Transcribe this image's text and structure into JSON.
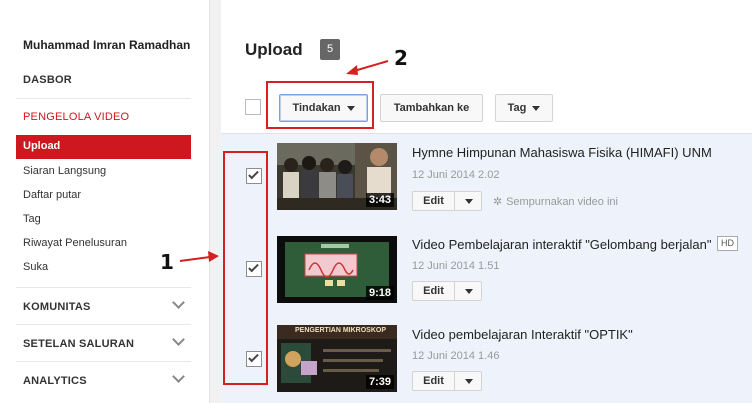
{
  "sidebar": {
    "user_name": "Muhammad Imran Ramadhan",
    "dasbor": "DASBOR",
    "section_title": "PENGELOLA VIDEO",
    "items": [
      {
        "label": "Upload",
        "active": true
      },
      {
        "label": "Siaran Langsung"
      },
      {
        "label": "Daftar putar"
      },
      {
        "label": "Tag"
      },
      {
        "label": "Riwayat Penelusuran"
      },
      {
        "label": "Suka"
      }
    ],
    "sections": [
      {
        "label": "KOMUNITAS"
      },
      {
        "label": "SETELAN SALURAN"
      },
      {
        "label": "ANALYTICS"
      }
    ]
  },
  "header": {
    "title": "Upload",
    "count": "5"
  },
  "toolbar": {
    "actions_label": "Tindakan",
    "add_to_label": "Tambahkan ke",
    "tag_label": "Tag"
  },
  "videos": [
    {
      "title": "Hymne Himpunan Mahasiswa Fisika (HIMAFI) UNM",
      "date": "12 Juni 2014 2.02",
      "duration": "3:43",
      "edit": "Edit",
      "enhance": "Sempurnakan video ini",
      "checked": true
    },
    {
      "title": "Video Pembelajaran interaktif \"Gelombang berjalan\"",
      "hd": "HD",
      "date": "12 Juni 2014 1.51",
      "duration": "9:18",
      "edit": "Edit",
      "checked": true
    },
    {
      "title": "Video pembelajaran Interaktif \"OPTIK\"",
      "date": "12 Juni 2014 1.46",
      "duration": "7:39",
      "edit": "Edit",
      "checked": true,
      "thumb_caption": "PENGERTIAN MIKROSKOP"
    }
  ],
  "annotations": {
    "label_1": "1",
    "label_2": "2",
    "color": "#d42020"
  },
  "colors": {
    "accent": "#cc181e",
    "list_bg": "#eef3fb"
  }
}
